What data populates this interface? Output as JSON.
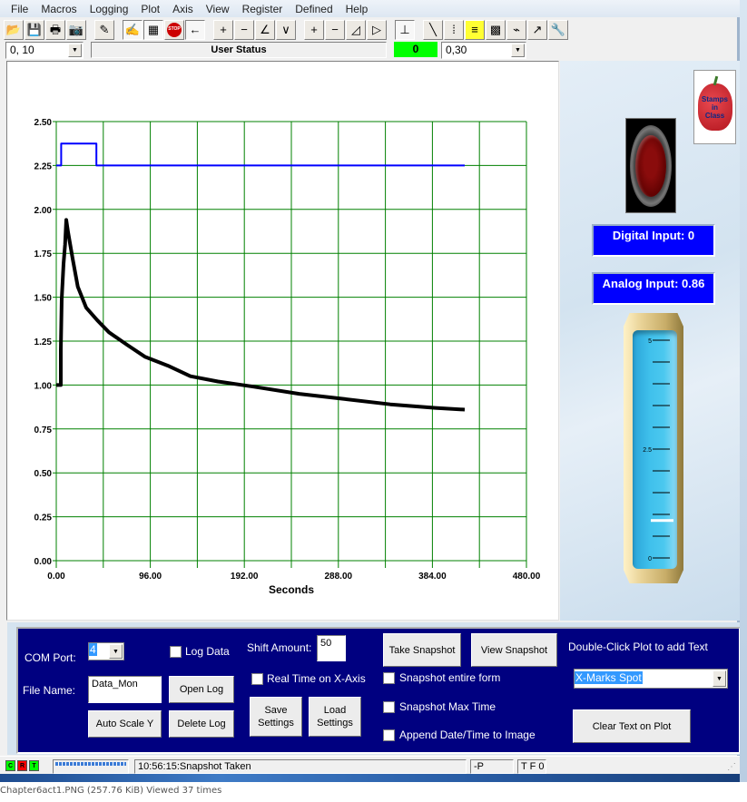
{
  "menu": [
    "File",
    "Macros",
    "Logging",
    "Plot",
    "Axis",
    "View",
    "Register",
    "Defined",
    "Help"
  ],
  "toolbar": {
    "buttons": [
      {
        "name": "open-folder-icon",
        "glyph": "📂"
      },
      {
        "name": "save-icon",
        "glyph": "💾"
      },
      {
        "name": "print-icon",
        "glyph": "🖶"
      },
      {
        "name": "camera-icon",
        "glyph": "📷"
      },
      {
        "name": "connect-wand-icon",
        "glyph": "✎"
      },
      {
        "name": "plot-pen-icon",
        "glyph": "✍"
      },
      {
        "name": "monitor-icon",
        "glyph": "▦"
      },
      {
        "name": "stop-icon",
        "glyph": "STOP"
      },
      {
        "name": "arrow-left-icon",
        "glyph": "←"
      },
      {
        "name": "y-zoom-in-icon",
        "glyph": "+"
      },
      {
        "name": "y-zoom-out-icon",
        "glyph": "−"
      },
      {
        "name": "y-shift-up-icon",
        "glyph": "∠"
      },
      {
        "name": "y-shift-down-icon",
        "glyph": "∨"
      },
      {
        "name": "x-zoom-in-icon",
        "glyph": "+"
      },
      {
        "name": "x-zoom-out-icon",
        "glyph": "−"
      },
      {
        "name": "x-shift-left-icon",
        "glyph": "◿"
      },
      {
        "name": "x-shift-right-icon",
        "glyph": "▷"
      },
      {
        "name": "axis-icon",
        "glyph": "⊥"
      },
      {
        "name": "pen-blue-icon",
        "glyph": "╲"
      },
      {
        "name": "scatter-plot-icon",
        "glyph": "⁞"
      },
      {
        "name": "notes-icon",
        "glyph": "≡"
      },
      {
        "name": "clear-trash-icon",
        "glyph": "▩"
      },
      {
        "name": "probe-icon",
        "glyph": "⌁"
      },
      {
        "name": "trend-icon",
        "glyph": "↗"
      },
      {
        "name": "wrench-icon",
        "glyph": "🔧"
      }
    ]
  },
  "combo_left": {
    "value": "0, 10"
  },
  "user_status": "User Status",
  "counter_value": "0",
  "combo_right": {
    "value": "0,30"
  },
  "chart_data": {
    "type": "line",
    "title": "",
    "xlabel": "Seconds",
    "ylabel": "",
    "xlim": [
      0,
      480
    ],
    "ylim": [
      0,
      2.5
    ],
    "x_ticks": [
      "0.00",
      "96.00",
      "192.00",
      "288.00",
      "384.00",
      "480.00"
    ],
    "x_tick_values": [
      0,
      96,
      192,
      288,
      384,
      480
    ],
    "x_grid_step": 48,
    "y_ticks": [
      "0.00",
      "0.25",
      "0.50",
      "0.75",
      "1.00",
      "1.25",
      "1.50",
      "1.75",
      "2.00",
      "2.25",
      "2.50"
    ],
    "y_tick_values": [
      0,
      0.25,
      0.5,
      0.75,
      1.0,
      1.25,
      1.5,
      1.75,
      2.0,
      2.25,
      2.5
    ],
    "grid": true,
    "grid_color": "#008000",
    "series": [
      {
        "name": "Digital",
        "color": "#0000ff",
        "step": true,
        "points": [
          [
            0,
            2.25
          ],
          [
            5,
            2.25
          ],
          [
            5,
            2.375
          ],
          [
            41,
            2.375
          ],
          [
            41,
            2.25
          ],
          [
            417,
            2.25
          ]
        ]
      },
      {
        "name": "Analog",
        "color": "#000000",
        "step": false,
        "points": [
          [
            0,
            1.0
          ],
          [
            4.6,
            1.0
          ],
          [
            4.6,
            1.2
          ],
          [
            5.6,
            1.49
          ],
          [
            7.4,
            1.69
          ],
          [
            9,
            1.8
          ],
          [
            10.2,
            1.94
          ],
          [
            12,
            1.87
          ],
          [
            16.7,
            1.72
          ],
          [
            22,
            1.56
          ],
          [
            30.6,
            1.44
          ],
          [
            41.7,
            1.37
          ],
          [
            53.8,
            1.3
          ],
          [
            72,
            1.23
          ],
          [
            90.8,
            1.16
          ],
          [
            114,
            1.11
          ],
          [
            137,
            1.05
          ],
          [
            165,
            1.02
          ],
          [
            202,
            0.99
          ],
          [
            248,
            0.95
          ],
          [
            295,
            0.92
          ],
          [
            341,
            0.89
          ],
          [
            387,
            0.87
          ],
          [
            417,
            0.86
          ]
        ]
      }
    ]
  },
  "right_panel": {
    "logo_text": [
      "Stamps",
      "in",
      "Class"
    ],
    "digital_input": "Digital Input: 0",
    "analog_input": "Analog Input: 0.86",
    "gauge": {
      "min": 0,
      "max": 5,
      "labels": [
        "5",
        "2.5",
        "0"
      ],
      "value": 0.86
    }
  },
  "controls": {
    "com_port_label": "COM Port:",
    "com_port_value": "4",
    "log_data_label": "Log Data",
    "shift_amount_label": "Shift Amount:",
    "shift_amount_value": "50",
    "file_name_label": "File Name:",
    "file_name_value": "Data_Mon",
    "open_log": "Open Log",
    "delete_log": "Delete Log",
    "auto_scale_y": "Auto Scale Y",
    "real_time_label": "Real Time on X-Axis",
    "save_settings": "Save Settings",
    "load_settings": "Load Settings",
    "take_snapshot": "Take Snapshot",
    "view_snapshot": "View Snapshot",
    "snapshot_entire_form": "Snapshot entire form",
    "snapshot_max_time": "Snapshot Max Time",
    "append_datetime": "Append Date/Time to Image",
    "double_click_hint": "Double-Click Plot to add Text",
    "text_select_value": "X-Marks Spot",
    "clear_text": "Clear Text on Plot"
  },
  "statusbar": {
    "leds": [
      {
        "label": "C",
        "color": "#00ff00"
      },
      {
        "label": "R",
        "color": "#ff0000"
      },
      {
        "label": "T",
        "color": "#00ff00"
      }
    ],
    "message": "10:56:15:Snapshot Taken",
    "field2": "-P",
    "field3": "T F 0"
  },
  "caption": "Chapter6act1.PNG (257.76 KiB) Viewed 37 times"
}
